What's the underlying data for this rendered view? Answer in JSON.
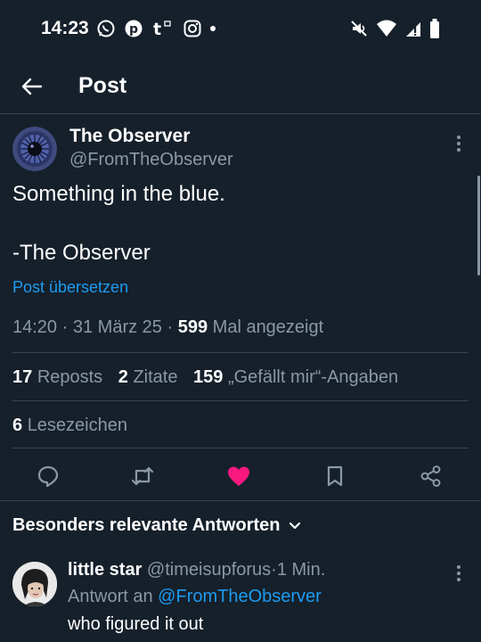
{
  "status_bar": {
    "time": "14:23",
    "notification_icons": [
      "whatsapp-icon",
      "pinterest-icon",
      "tumblr-icon",
      "instagram-icon",
      "more-dot"
    ],
    "system_icons": [
      "mute-icon",
      "wifi-icon",
      "signal-icon",
      "battery-icon"
    ]
  },
  "header": {
    "title": "Post"
  },
  "post": {
    "author_name": "The Observer",
    "author_handle": "@FromTheObserver",
    "text_line1": "Something in the blue.",
    "text_line2": "-The Observer",
    "translate_label": "Post übersetzen",
    "time": "14:20",
    "date": "31 März 25",
    "views_count": "599",
    "views_label": "Mal angezeigt",
    "separator": "·"
  },
  "stats": {
    "reposts_count": "17",
    "reposts_label": "Reposts",
    "quotes_count": "2",
    "quotes_label": "Zitate",
    "likes_count": "159",
    "likes_label": "„Gefällt mir“-Angaben",
    "bookmarks_count": "6",
    "bookmarks_label": "Lesezeichen"
  },
  "actions": [
    "reply-icon",
    "repost-icon",
    "like-icon",
    "bookmark-icon",
    "share-icon"
  ],
  "replies": {
    "sort_label": "Besonders relevante Antworten",
    "items": [
      {
        "name": "little star",
        "handle": "@timeisupforus",
        "separator": "·",
        "time": "1 Min.",
        "reply_to_label": "Antwort an",
        "reply_to_handle": "@FromTheObserver",
        "text": "who figured it out"
      }
    ]
  },
  "colors": {
    "background": "#15202b",
    "divider": "#38444d",
    "secondary_text": "#8b98a5",
    "accent": "#1d9bf0",
    "like": "#f91880"
  }
}
